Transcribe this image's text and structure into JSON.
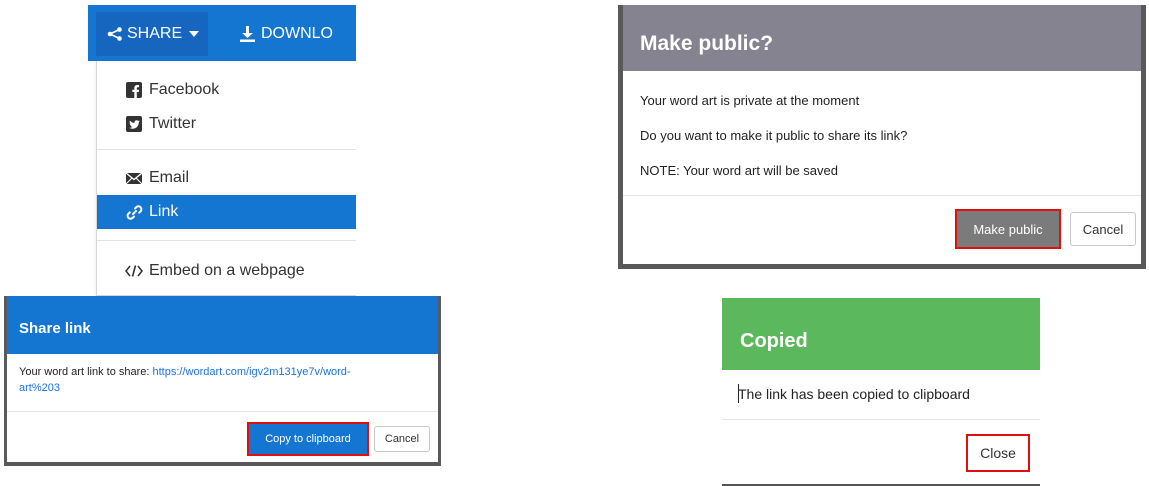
{
  "share_menu": {
    "share_label": "SHARE",
    "download_label": "DOWNLO",
    "items": [
      {
        "label": "Facebook",
        "icon": "facebook-icon"
      },
      {
        "label": "Twitter",
        "icon": "twitter-icon"
      },
      {
        "label": "Email",
        "icon": "email-icon"
      },
      {
        "label": "Link",
        "icon": "link-icon",
        "active": true
      },
      {
        "label": "Embed on a webpage",
        "icon": "code-icon"
      }
    ]
  },
  "make_public_modal": {
    "title": "Make public?",
    "lines": [
      "Your word art is private at the moment",
      "Do you want to make it public to share its link?",
      "NOTE: Your word art will be saved"
    ],
    "primary_button": "Make public",
    "cancel_button": "Cancel",
    "header_color": "#858390"
  },
  "share_link_modal": {
    "title": "Share link",
    "body_prefix": "Your word art link to share: ",
    "url_line1": "https://wordart.com/igv2m131ye7v/word-",
    "url_line2": "art%203",
    "copy_button": "Copy to clipboard",
    "cancel_button": "Cancel",
    "header_color": "#1576d2"
  },
  "copied_modal": {
    "title": "Copied",
    "message": "The link has been copied to clipboard",
    "close_button": "Close",
    "header_color": "#5cb85c"
  },
  "highlight_color": "#e01010"
}
